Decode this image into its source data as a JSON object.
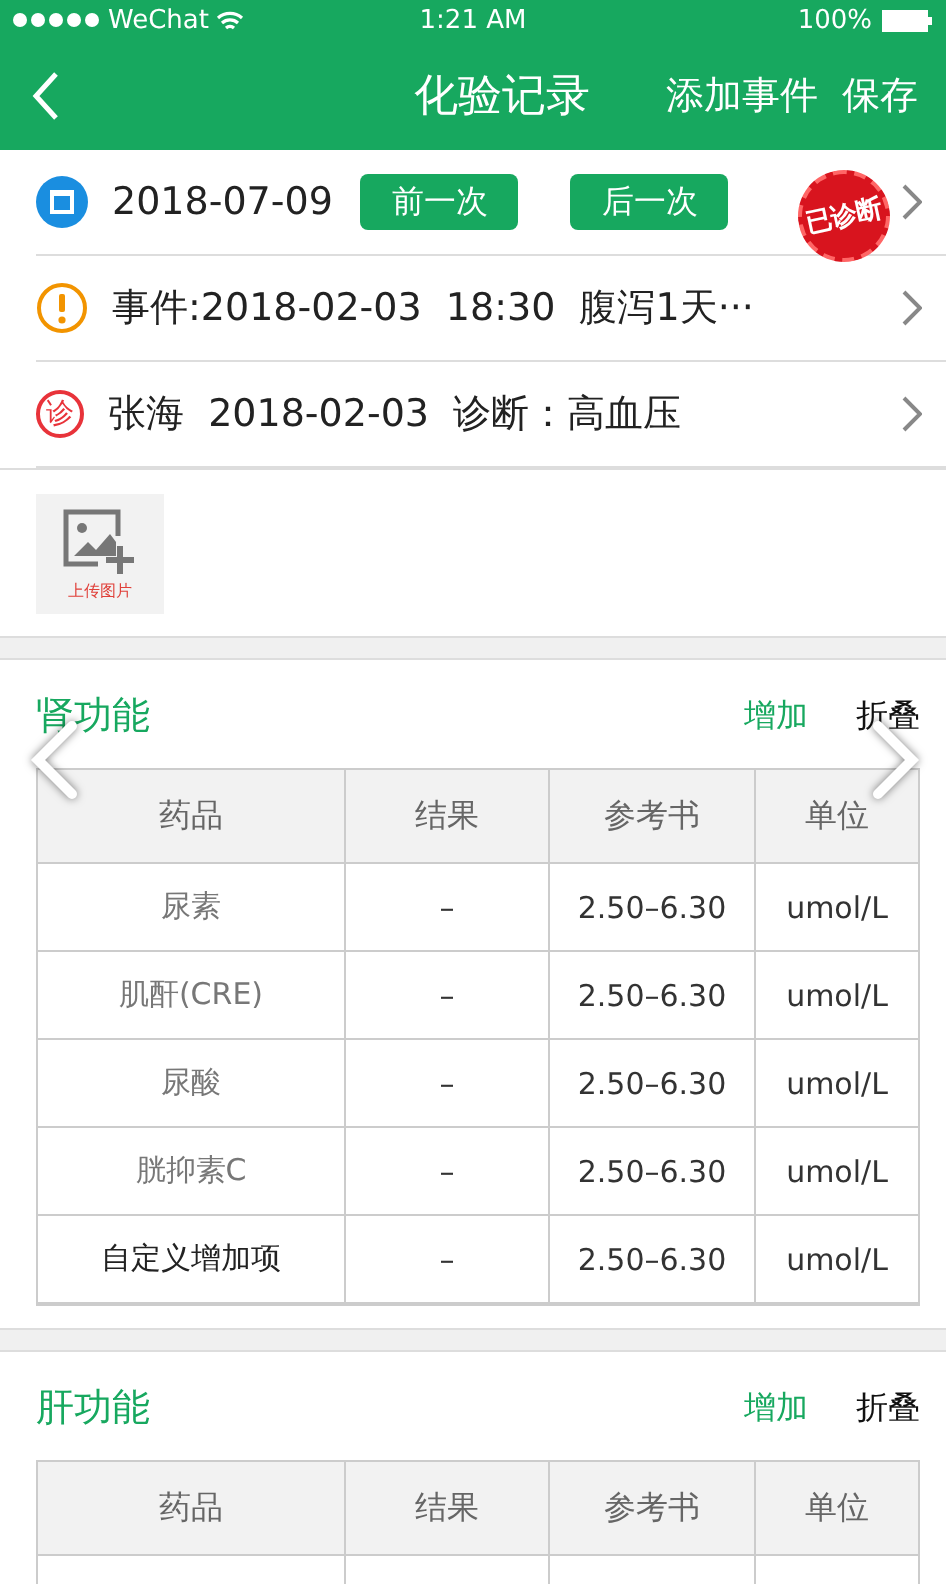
{
  "status_bar": {
    "carrier": "WeChat",
    "time": "1:21 AM",
    "battery": "100%"
  },
  "nav": {
    "title": "化验记录",
    "actions": [
      "添加事件",
      "保存"
    ]
  },
  "info_rows": [
    {
      "kind": "date",
      "text": "2018-07-09",
      "buttons": [
        "前一次",
        "后一次"
      ],
      "stamp": "已诊断"
    },
    {
      "kind": "event",
      "text": "事件:2018-02-03  18:30  腹泻1天···"
    },
    {
      "kind": "diagnosis",
      "icon_text": "诊",
      "text": "张海  2018-02-03  诊断：高血压"
    }
  ],
  "upload": {
    "label": "上传图片"
  },
  "sections": [
    {
      "title": "肾功能",
      "add": "增加",
      "collapse": "折叠",
      "columns": [
        "药品",
        "结果",
        "参考书",
        "单位"
      ],
      "rows": [
        {
          "kind": "preset",
          "cells": [
            "尿素",
            "–",
            "2.50–6.30",
            "umol/L"
          ]
        },
        {
          "kind": "preset",
          "cells": [
            "肌酐(CRE)",
            "–",
            "2.50–6.30",
            "umol/L"
          ]
        },
        {
          "kind": "preset",
          "cells": [
            "尿酸",
            "–",
            "2.50–6.30",
            "umol/L"
          ]
        },
        {
          "kind": "preset",
          "cells": [
            "胱抑素C",
            "–",
            "2.50–6.30",
            "umol/L"
          ]
        },
        {
          "kind": "custom",
          "cells": [
            "自定义增加项",
            "–",
            "2.50–6.30",
            "umol/L"
          ]
        }
      ]
    },
    {
      "title": "肝功能",
      "add": "增加",
      "collapse": "折叠",
      "columns": [
        "药品",
        "结果",
        "参考书",
        "单位"
      ]
    }
  ]
}
